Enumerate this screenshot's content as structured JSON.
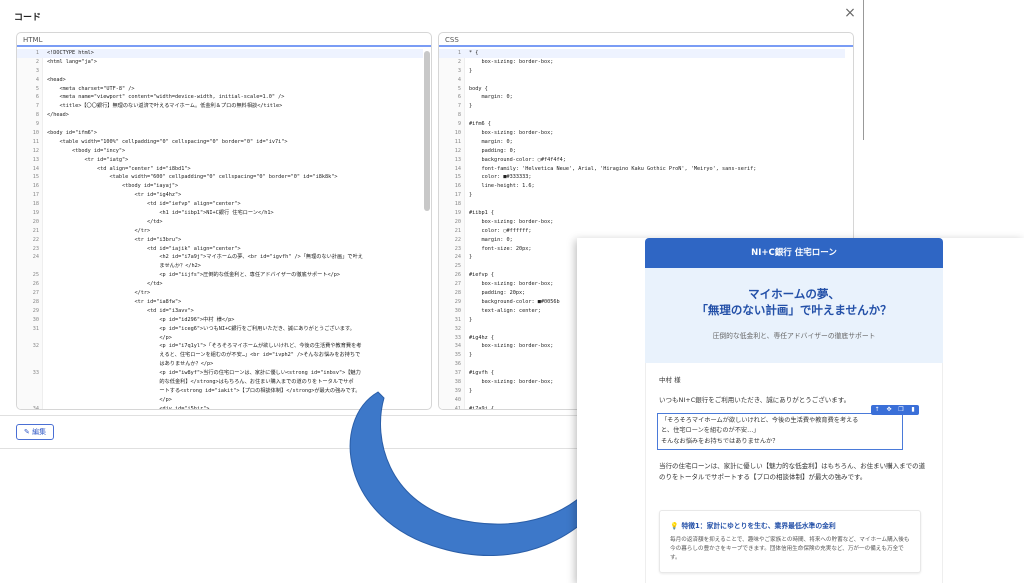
{
  "dialog": {
    "title": "コード",
    "close_glyph": "×",
    "html_pane_label": "HTML",
    "css_pane_label": "CSS",
    "edit_button_label": "✎ 編集"
  },
  "html_code": [
    {
      "n": "1",
      "t": "<!DOCTYPE html>"
    },
    {
      "n": "2",
      "t": "<html lang=\"ja\">"
    },
    {
      "n": "3",
      "t": ""
    },
    {
      "n": "4",
      "t": "<head>"
    },
    {
      "n": "5",
      "t": "    <meta charset=\"UTF-8\" />"
    },
    {
      "n": "6",
      "t": "    <meta name=\"viewport\" content=\"width=device-width, initial-scale=1.0\" />"
    },
    {
      "n": "7",
      "t": "    <title>【〇〇銀行】無理のない返済で叶えるマイホーム。低金利＆プロの無料相談</title>"
    },
    {
      "n": "8",
      "t": "</head>"
    },
    {
      "n": "9",
      "t": ""
    },
    {
      "n": "10",
      "t": "<body id=\"ifm6\">"
    },
    {
      "n": "11",
      "t": "    <table width=\"100%\" cellpadding=\"0\" cellspacing=\"0\" border=\"0\" id=\"iv7i\">"
    },
    {
      "n": "12",
      "t": "        <tbody id=\"incy\">"
    },
    {
      "n": "13",
      "t": "            <tr id=\"iatg\">"
    },
    {
      "n": "14",
      "t": "                <td align=\"center\" id=\"i8bd1\">"
    },
    {
      "n": "15",
      "t": "                    <table width=\"600\" cellpadding=\"0\" cellspacing=\"0\" border=\"0\" id=\"i8k8k\">"
    },
    {
      "n": "16",
      "t": "                        <tbody id=\"iayaj\">"
    },
    {
      "n": "17",
      "t": "                            <tr id=\"ig4hz\">"
    },
    {
      "n": "18",
      "t": "                                <td id=\"iefvp\" align=\"center\">"
    },
    {
      "n": "19",
      "t": "                                    <h1 id=\"iibp1\">NI+C銀行 住宅ローン</h1>"
    },
    {
      "n": "20",
      "t": "                                </td>"
    },
    {
      "n": "21",
      "t": "                            </tr>"
    },
    {
      "n": "22",
      "t": "                            <tr id=\"i3bru\">"
    },
    {
      "n": "23",
      "t": "                                <td id=\"iajik\" align=\"center\">"
    },
    {
      "n": "24",
      "t": "                                    <h2 id=\"i7a9j\">マイホームの夢、<br id=\"igvfh\" />「無理のない計画」で叶え"
    },
    {
      "n": "",
      "t": "                                    ませんか？</h2>"
    },
    {
      "n": "25",
      "t": "                                    <p id=\"iijfs\">圧倒的な低金利と、専任アドバイザーの徹底サポート</p>"
    },
    {
      "n": "26",
      "t": "                                </td>"
    },
    {
      "n": "27",
      "t": "                            </tr>"
    },
    {
      "n": "28",
      "t": "                            <tr id=\"ia8fw\">"
    },
    {
      "n": "29",
      "t": "                                <td id=\"i3avv\">"
    },
    {
      "n": "30",
      "t": "                                    <p id=\"id296\">中村 様</p>"
    },
    {
      "n": "31",
      "t": "                                    <p id=\"iceg6\">いつもNI+C銀行をご利用いただき、誠にありがとうございます。"
    },
    {
      "n": "",
      "t": "                                    </p>"
    },
    {
      "n": "32",
      "t": "                                    <p id=\"i7q1yl\">「そろそろマイホームが欲しいけれど、今後の生活費や教育費を考"
    },
    {
      "n": "",
      "t": "                                    えると、住宅ローンを組むのが不安…」<br id=\"ivph2\" />そんなお悩みをお持ちで"
    },
    {
      "n": "",
      "t": "                                    はありませんか？</p>"
    },
    {
      "n": "33",
      "t": "                                    <p id=\"iw8yf\">当行の住宅ローンは、家計に優しい<strong id=\"inbsv\">【魅力"
    },
    {
      "n": "",
      "t": "                                    的な低金利】</strong>はもちろん、お住まい購入までの道のりをトータルでサポ"
    },
    {
      "n": "",
      "t": "                                    ートする<strong id=\"iakit\">【プロの相談体制】</strong>が最大の強みです。"
    },
    {
      "n": "",
      "t": "                                    </p>"
    },
    {
      "n": "34",
      "t": "                                    <div id=\"i5hir\">"
    }
  ],
  "css_code": [
    {
      "n": "1",
      "t": "* {"
    },
    {
      "n": "2",
      "t": "    box-sizing: border-box;"
    },
    {
      "n": "3",
      "t": "}"
    },
    {
      "n": "4",
      "t": ""
    },
    {
      "n": "5",
      "t": "body {"
    },
    {
      "n": "6",
      "t": "    margin: 0;"
    },
    {
      "n": "7",
      "t": "}"
    },
    {
      "n": "8",
      "t": ""
    },
    {
      "n": "9",
      "t": "#ifm6 {"
    },
    {
      "n": "10",
      "t": "    box-sizing: border-box;"
    },
    {
      "n": "11",
      "t": "    margin: 0;"
    },
    {
      "n": "12",
      "t": "    padding: 0;"
    },
    {
      "n": "13",
      "t": "    background-color: ▢#f4f4f4;"
    },
    {
      "n": "14",
      "t": "    font-family: 'Helvetica Neue', Arial, 'Hiragino Kaku Gothic ProN', 'Meiryo', sans-serif;"
    },
    {
      "n": "15",
      "t": "    color: ■#333333;"
    },
    {
      "n": "16",
      "t": "    line-height: 1.6;"
    },
    {
      "n": "17",
      "t": "}"
    },
    {
      "n": "18",
      "t": ""
    },
    {
      "n": "19",
      "t": "#iibp1 {"
    },
    {
      "n": "20",
      "t": "    box-sizing: border-box;"
    },
    {
      "n": "21",
      "t": "    color: ▢#ffffff;"
    },
    {
      "n": "22",
      "t": "    margin: 0;"
    },
    {
      "n": "23",
      "t": "    font-size: 20px;"
    },
    {
      "n": "24",
      "t": "}"
    },
    {
      "n": "25",
      "t": ""
    },
    {
      "n": "26",
      "t": "#iefvp {"
    },
    {
      "n": "27",
      "t": "    box-sizing: border-box;"
    },
    {
      "n": "28",
      "t": "    padding: 20px;"
    },
    {
      "n": "29",
      "t": "    background-color: ■#0056b"
    },
    {
      "n": "30",
      "t": "    text-align: center;"
    },
    {
      "n": "31",
      "t": "}"
    },
    {
      "n": "32",
      "t": ""
    },
    {
      "n": "33",
      "t": "#ig4hz {"
    },
    {
      "n": "34",
      "t": "    box-sizing: border-box;"
    },
    {
      "n": "35",
      "t": "}"
    },
    {
      "n": "36",
      "t": ""
    },
    {
      "n": "37",
      "t": "#igvfh {"
    },
    {
      "n": "38",
      "t": "    box-sizing: border-box;"
    },
    {
      "n": "39",
      "t": "}"
    },
    {
      "n": "40",
      "t": ""
    },
    {
      "n": "41",
      "t": "#i7a9j {"
    }
  ],
  "preview": {
    "header_title": "NI+C銀行 住宅ローン",
    "hero_line1": "マイホームの夢、",
    "hero_line2": "「無理のない計画」で叶えませんか？",
    "hero_sub": "圧倒的な低金利と、専任アドバイザーの徹底サポート",
    "greeting": "中村 様",
    "thanks": "いつもNI+C銀行をご利用いただき、誠にありがとうございます。",
    "quote_line1": "「そろそろマイホームが欲しいけれど、今後の生活費や教育費を考える",
    "quote_line2": "と、住宅ローンを組むのが不安…」",
    "quote_line3": "そんなお悩みをお持ちではありませんか？",
    "intro": "当行の住宅ローンは、家計に優しい【魅力的な低金利】はもちろん、お住まい購入までの道のりをトータルでサポートする【プロの相談体制】が最大の強みです。",
    "feature_title": "特徴1：家計にゆとりを生む、業界最低水準の金利",
    "feature_desc": "毎月の返済額を抑えることで、趣味やご家族との時間、将来への貯蓄など、マイホーム購入後も今の暮らしの豊かさをキープできます。団体信用生命保険の充実など、万が一の備えも万全です。",
    "toolbar_icons": [
      "arrow-up-icon",
      "move-icon",
      "copy-icon",
      "delete-icon"
    ]
  },
  "colors": {
    "accent_blue": "#2f66c4",
    "hero_bg": "#e9f2fc",
    "arrow_blue": "#3d78c9"
  }
}
